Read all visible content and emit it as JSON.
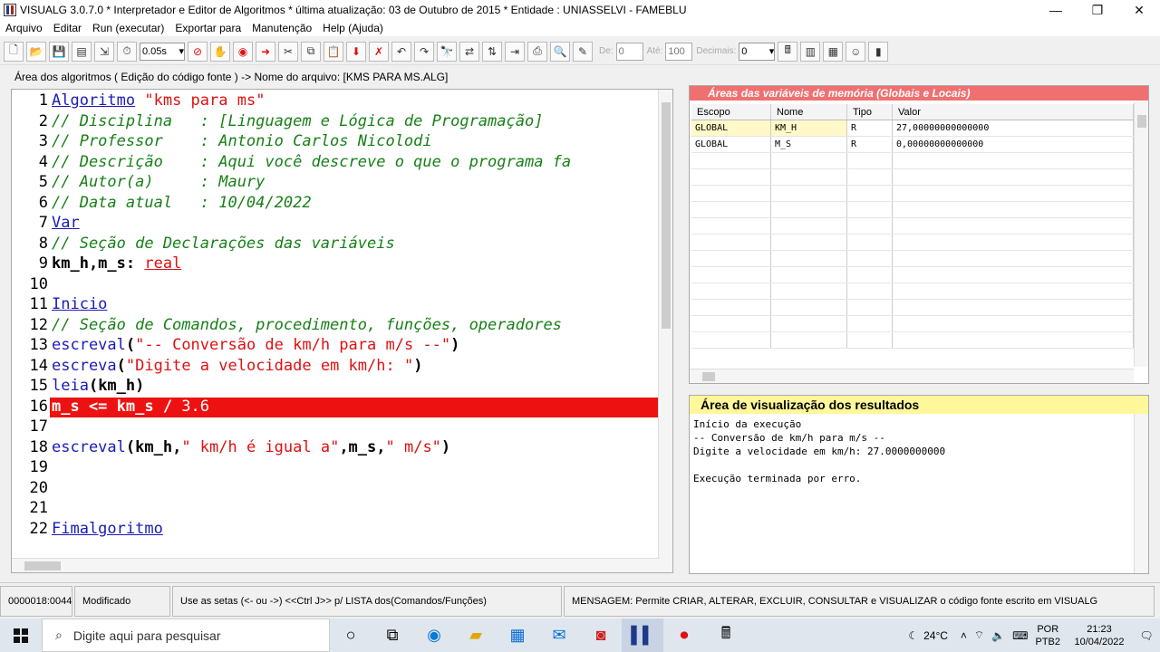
{
  "window": {
    "title": "VISUALG 3.0.7.0 * Interpretador e Editor de Algoritmos * última atualização: 03 de Outubro de 2015 * Entidade : UNIASSELVI - FAMEBLU"
  },
  "menu": [
    "Arquivo",
    "Editar",
    "Run (executar)",
    "Exportar para",
    "Manutenção",
    "Help (Ajuda)"
  ],
  "toolbar": {
    "speed_value": "0.05s",
    "de_label": "De:",
    "de_value": "0",
    "ate_label": "Até:",
    "ate_value": "100",
    "decimais_label": "Decimais:",
    "decimais_value": "0"
  },
  "editor_bar": "Área dos algoritmos ( Edição do código fonte ) -> Nome do arquivo: [KMS PARA MS.ALG]",
  "code_lines": [
    {
      "num": "1",
      "text": "Algoritmo \"kms para ms\""
    },
    {
      "num": "2",
      "text": "// Disciplina   : [Linguagem e Lógica de Programação]"
    },
    {
      "num": "3",
      "text": "// Professor    : Antonio Carlos Nicolodi"
    },
    {
      "num": "4",
      "text": "// Descrição    : Aqui você descreve o que o programa fa"
    },
    {
      "num": "5",
      "text": "// Autor(a)     : Maury"
    },
    {
      "num": "6",
      "text": "// Data atual   : 10/04/2022"
    },
    {
      "num": "7",
      "text": "Var"
    },
    {
      "num": "8",
      "text": "// Seção de Declarações das variáveis"
    },
    {
      "num": "9",
      "text": "km_h,m_s: real"
    },
    {
      "num": "10",
      "text": ""
    },
    {
      "num": "11",
      "text": "Inicio"
    },
    {
      "num": "12",
      "text": "// Seção de Comandos, procedimento, funções, operadores"
    },
    {
      "num": "13",
      "text": "escreval(\"-- Conversão de km/h para m/s --\")"
    },
    {
      "num": "14",
      "text": "escreva(\"Digite a velocidade em km/h: \")"
    },
    {
      "num": "15",
      "text": "leia(km_h)"
    },
    {
      "num": "16",
      "text": "m_s <= km_s / 3.6"
    },
    {
      "num": "17",
      "text": ""
    },
    {
      "num": "18",
      "text": "escreval(km_h,\" km/h é igual a\",m_s,\" m/s\")"
    },
    {
      "num": "19",
      "text": ""
    },
    {
      "num": "20",
      "text": ""
    },
    {
      "num": "21",
      "text": ""
    },
    {
      "num": "22",
      "text": "Fimalgoritmo"
    }
  ],
  "variables": {
    "header": "Áreas das variáveis de memória (Globais e Locais)",
    "columns": [
      "Escopo",
      "Nome",
      "Tipo",
      "Valor"
    ],
    "rows": [
      [
        "GLOBAL",
        "KM_H",
        "R",
        "27,00000000000000"
      ],
      [
        "GLOBAL",
        "M_S",
        "R",
        "0,00000000000000"
      ]
    ]
  },
  "results": {
    "header": "Área de visualização dos resultados",
    "text": "Início da execução\n-- Conversão de km/h para m/s --\nDigite a velocidade em km/h: 27.0000000000\n\nExecução terminada por erro."
  },
  "status": {
    "position": "0000018:0044",
    "state": "Modificado",
    "hint": "Use as setas (<- ou ->) <<Ctrl J>> p/ LISTA dos(Comandos/Funções)",
    "message": "MENSAGEM: Permite CRIAR, ALTERAR, EXCLUIR, CONSULTAR e VISUALIZAR o código fonte escrito em VISUALG"
  },
  "taskbar": {
    "search_placeholder": "Digite aqui para pesquisar",
    "temperature": "24°C",
    "language": "POR",
    "keyboard": "PTB2",
    "time": "21:23",
    "date": "10/04/2022"
  }
}
